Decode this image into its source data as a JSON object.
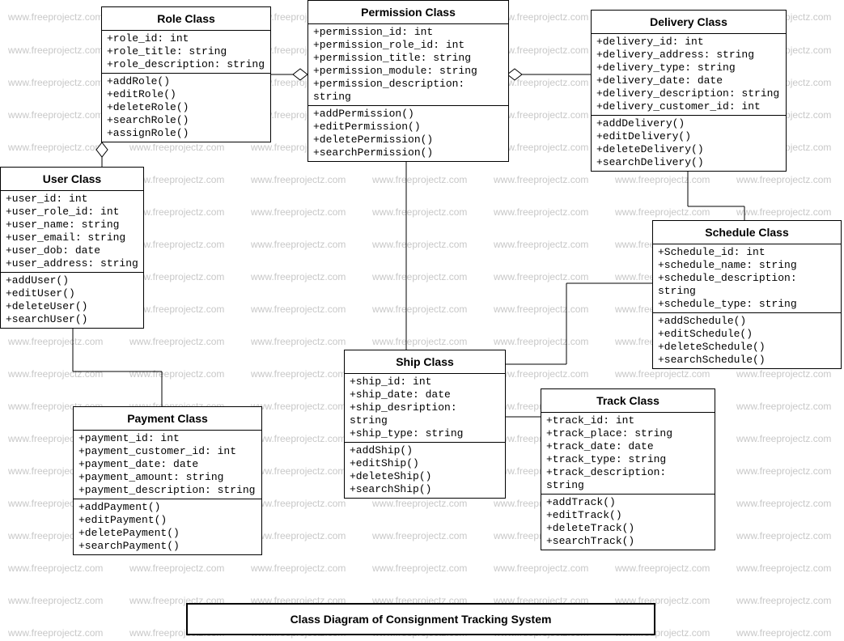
{
  "watermark": "www.freeprojectz.com",
  "caption": "Class Diagram of Consignment Tracking System",
  "classes": {
    "role": {
      "title": "Role Class",
      "attrs": [
        "+role_id: int",
        "+role_title: string",
        "+role_description: string"
      ],
      "ops": [
        "+addRole()",
        "+editRole()",
        "+deleteRole()",
        "+searchRole()",
        "+assignRole()"
      ]
    },
    "permission": {
      "title": "Permission Class",
      "attrs": [
        "+permission_id: int",
        "+permission_role_id: int",
        "+permission_title: string",
        "+permission_module: string",
        "+permission_description: string"
      ],
      "ops": [
        "+addPermission()",
        "+editPermission()",
        "+deletePermission()",
        "+searchPermission()"
      ]
    },
    "delivery": {
      "title": "Delivery Class",
      "attrs": [
        "+delivery_id: int",
        "+delivery_address: string",
        "+delivery_type: string",
        "+delivery_date: date",
        "+delivery_description: string",
        "+delivery_customer_id: int"
      ],
      "ops": [
        "+addDelivery()",
        "+editDelivery()",
        "+deleteDelivery()",
        "+searchDelivery()"
      ]
    },
    "user": {
      "title": "User Class",
      "attrs": [
        "+user_id: int",
        "+user_role_id: int",
        "+user_name: string",
        "+user_email: string",
        "+user_dob: date",
        "+user_address: string"
      ],
      "ops": [
        "+addUser()",
        "+editUser()",
        "+deleteUser()",
        "+searchUser()"
      ]
    },
    "schedule": {
      "title": "Schedule Class",
      "attrs": [
        "+Schedule_id: int",
        "+schedule_name: string",
        "+schedule_description: string",
        "+schedule_type: string"
      ],
      "ops": [
        "+addSchedule()",
        "+editSchedule()",
        "+deleteSchedule()",
        "+searchSchedule()"
      ]
    },
    "ship": {
      "title": "Ship Class",
      "attrs": [
        "+ship_id: int",
        "+ship_date: date",
        "+ship_desription: string",
        "+ship_type: string"
      ],
      "ops": [
        "+addShip()",
        "+editShip()",
        "+deleteShip()",
        "+searchShip()"
      ]
    },
    "payment": {
      "title": "Payment Class",
      "attrs": [
        "+payment_id: int",
        "+payment_customer_id: int",
        "+payment_date: date",
        "+payment_amount: string",
        "+payment_description: string"
      ],
      "ops": [
        "+addPayment()",
        "+editPayment()",
        "+deletePayment()",
        "+searchPayment()"
      ]
    },
    "track": {
      "title": "Track Class",
      "attrs": [
        "+track_id: int",
        "+track_place: string",
        "+track_date: date",
        "+track_type: string",
        "+track_description: string"
      ],
      "ops": [
        "+addTrack()",
        "+editTrack()",
        "+deleteTrack()",
        "+searchTrack()"
      ]
    }
  }
}
